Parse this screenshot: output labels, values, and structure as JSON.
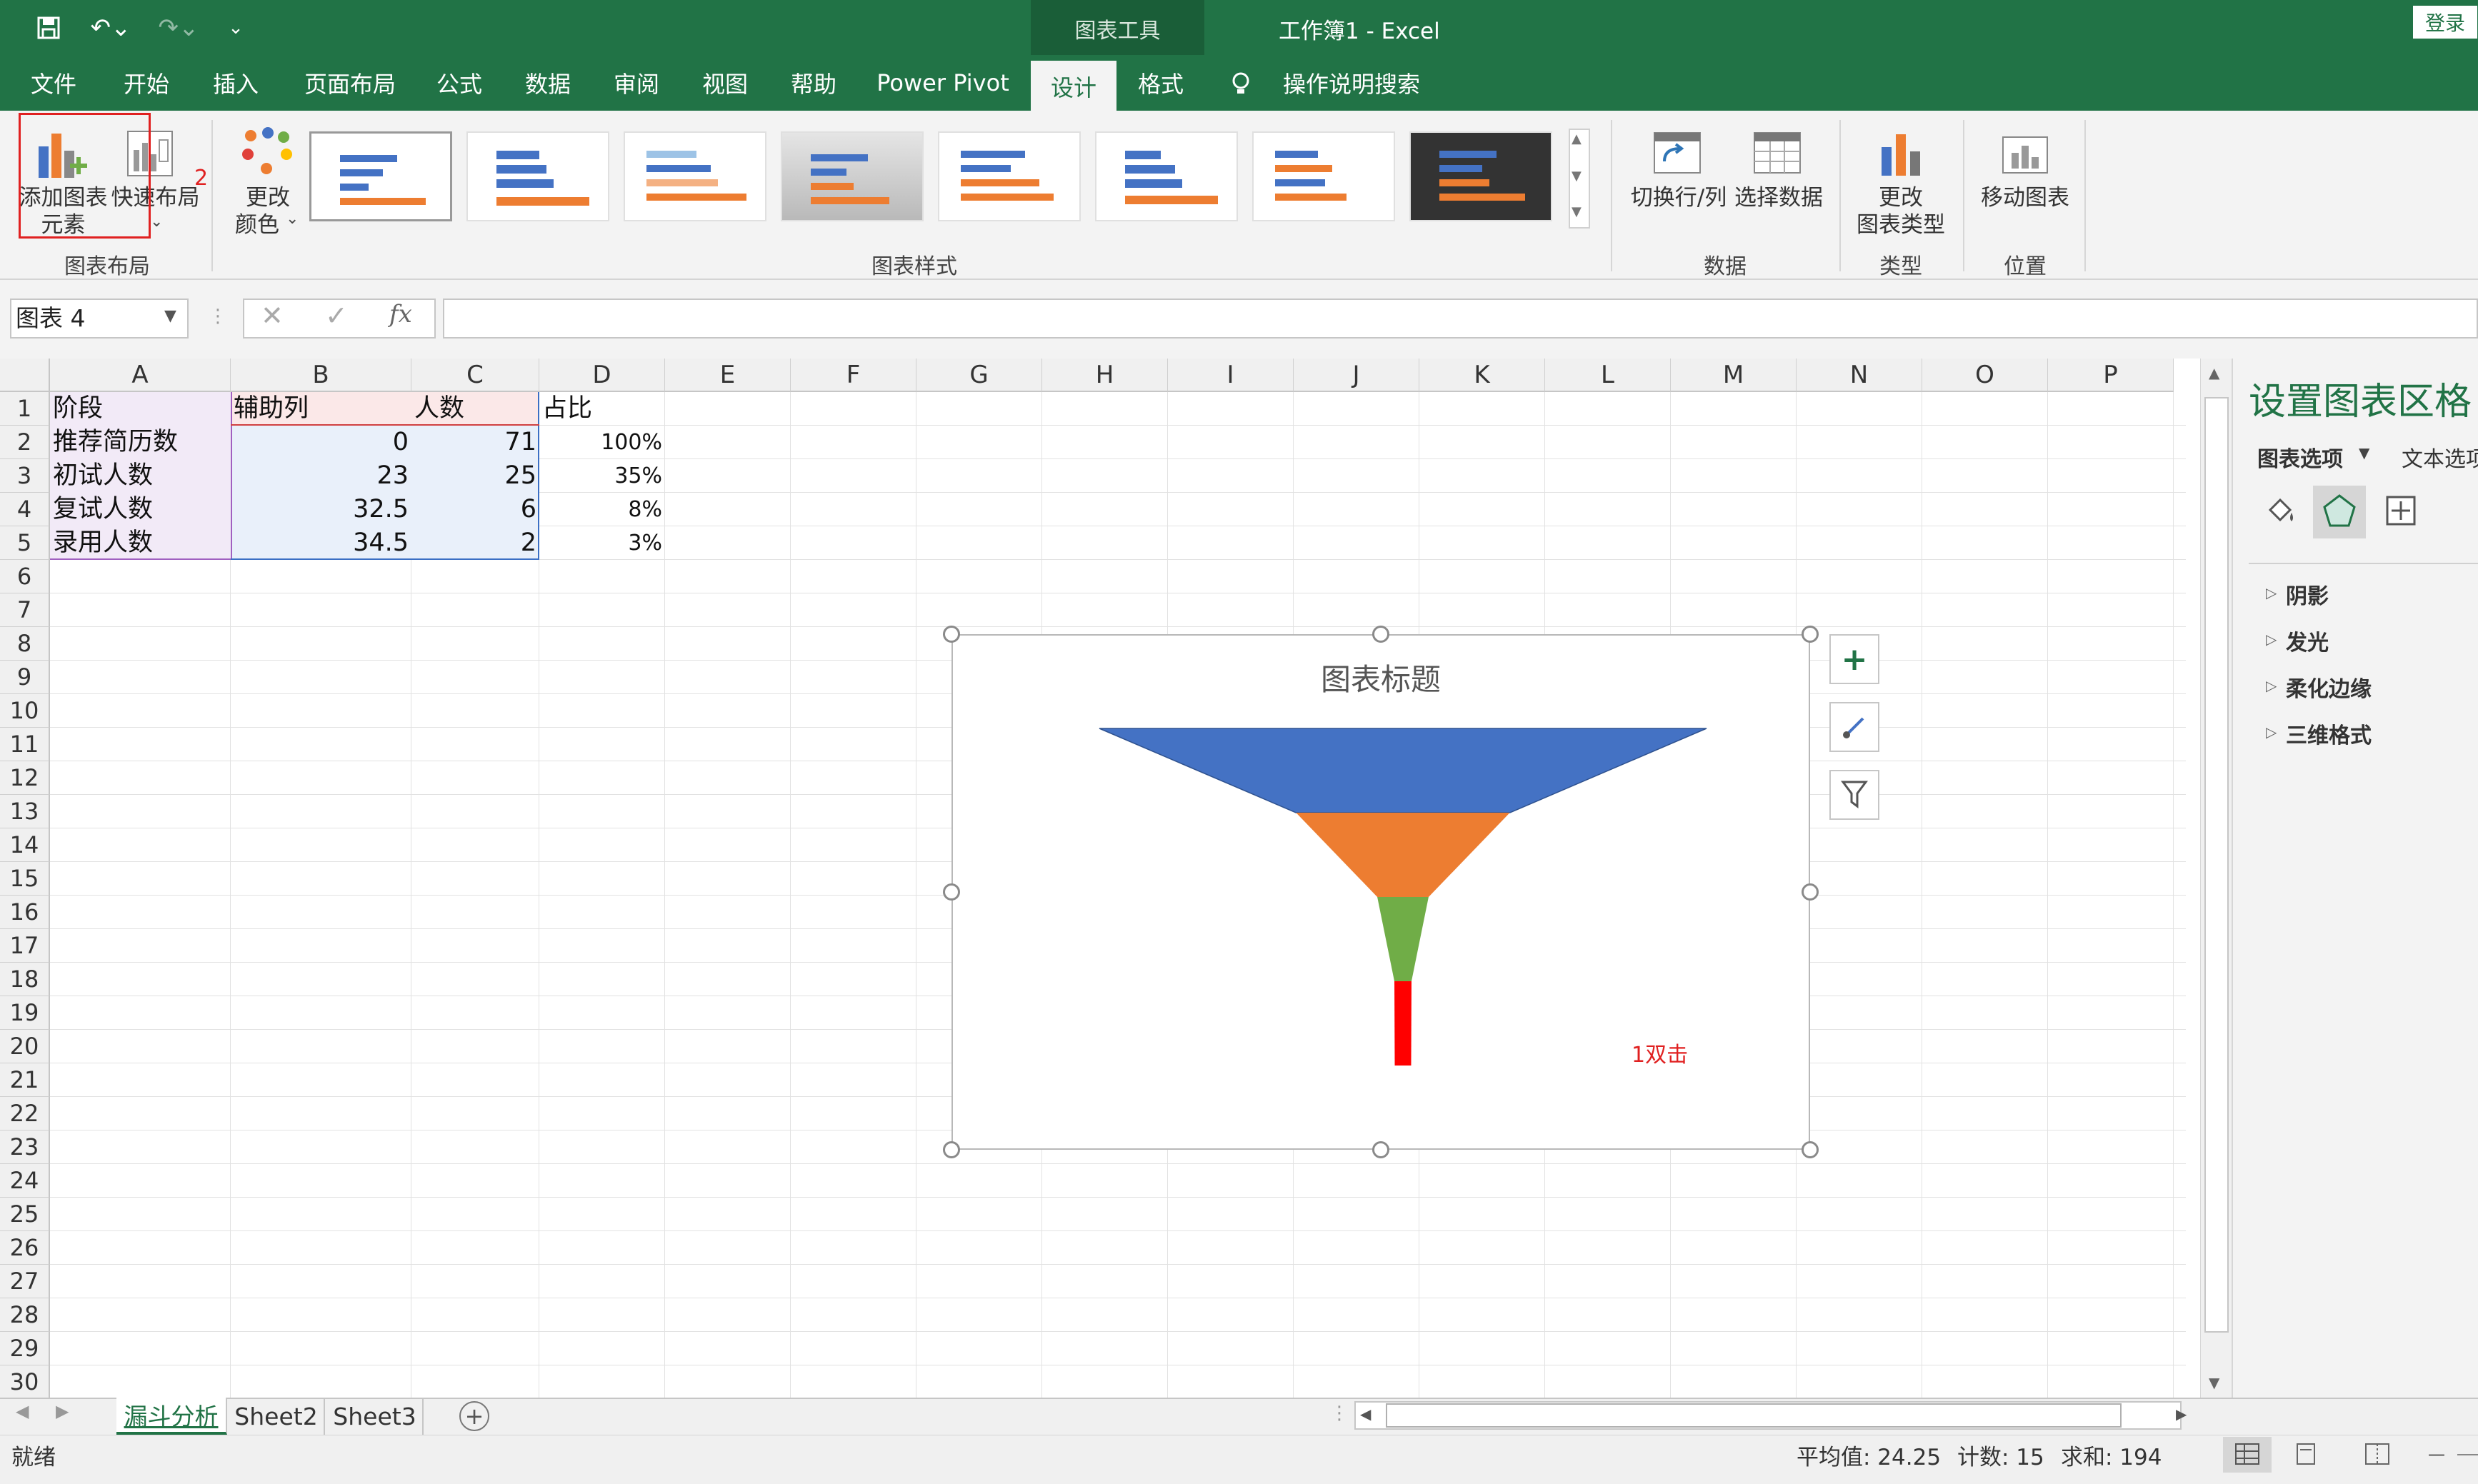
{
  "titlebar": {
    "chart_tools": "图表工具",
    "doc_title": "工作簿1  -  Excel",
    "login": "登录"
  },
  "tabs": [
    {
      "label": "文件"
    },
    {
      "label": "开始"
    },
    {
      "label": "插入"
    },
    {
      "label": "页面布局"
    },
    {
      "label": "公式"
    },
    {
      "label": "数据"
    },
    {
      "label": "审阅"
    },
    {
      "label": "视图"
    },
    {
      "label": "帮助"
    },
    {
      "label": "Power Pivot"
    },
    {
      "label": "设计"
    },
    {
      "label": "格式"
    },
    {
      "label": "操作说明搜索"
    }
  ],
  "ribbon": {
    "add_chart_element": [
      "添加图表",
      "元素"
    ],
    "quick_layout": "快速布局",
    "change_colors": [
      "更改",
      "颜色"
    ],
    "switch_row_col": "切换行/列",
    "select_data": "选择数据",
    "change_chart_type": [
      "更改",
      "图表类型"
    ],
    "move_chart": "移动图表",
    "groups": {
      "chart_layouts": "图表布局",
      "chart_styles": "图表样式",
      "data": "数据",
      "type": "类型",
      "location": "位置"
    },
    "annotation_number": "2"
  },
  "formula_bar": {
    "name_box": "图表 4",
    "fx": "fx"
  },
  "columns": [
    "A",
    "B",
    "C",
    "D",
    "E",
    "F",
    "G",
    "H",
    "I",
    "J",
    "K",
    "L",
    "M",
    "N",
    "O",
    "P"
  ],
  "rows": [
    "1",
    "2",
    "3",
    "4",
    "5",
    "6",
    "7",
    "8",
    "9",
    "10",
    "11",
    "12",
    "13",
    "14",
    "15",
    "16",
    "17",
    "18",
    "19",
    "20",
    "21",
    "22",
    "23",
    "24",
    "25",
    "26",
    "27",
    "28",
    "29",
    "30"
  ],
  "cells": {
    "header": [
      "阶段",
      "辅助列",
      "人数",
      "占比"
    ],
    "data": [
      [
        "推荐简历数",
        "0",
        "71",
        "100%"
      ],
      [
        "初试人数",
        "23",
        "25",
        "35%"
      ],
      [
        "复试人数",
        "32.5",
        "6",
        "8%"
      ],
      [
        "录用人数",
        "34.5",
        "2",
        "3%"
      ]
    ]
  },
  "chart": {
    "title": "图表标题",
    "annotation": "1双击",
    "colors": [
      "#4472c4",
      "#ed7d31",
      "#70ad47",
      "#ff0000"
    ]
  },
  "chart_data": {
    "type": "bar",
    "subtype": "stacked-funnel",
    "categories": [
      "推荐简历数",
      "初试人数",
      "复试人数",
      "录用人数"
    ],
    "series": [
      {
        "values": [
          0,
          23,
          32.5,
          34.5
        ],
        "hidden": true
      },
      {
        "values": [
          71,
          25,
          6,
          2
        ]
      }
    ],
    "xlim": [
      0,
      71
    ],
    "title": "图表标题",
    "legend": "none",
    "grid": false
  },
  "pane": {
    "title": "设置图表区格",
    "chart_options": "图表选项",
    "text_options": "文本选项",
    "items": [
      "阴影",
      "发光",
      "柔化边缘",
      "三维格式"
    ]
  },
  "sheets": [
    "漏斗分析",
    "Sheet2",
    "Sheet3"
  ],
  "status": {
    "ready": "就绪",
    "average": "平均值: 24.25",
    "count": "计数: 15",
    "sum": "求和: 194"
  }
}
